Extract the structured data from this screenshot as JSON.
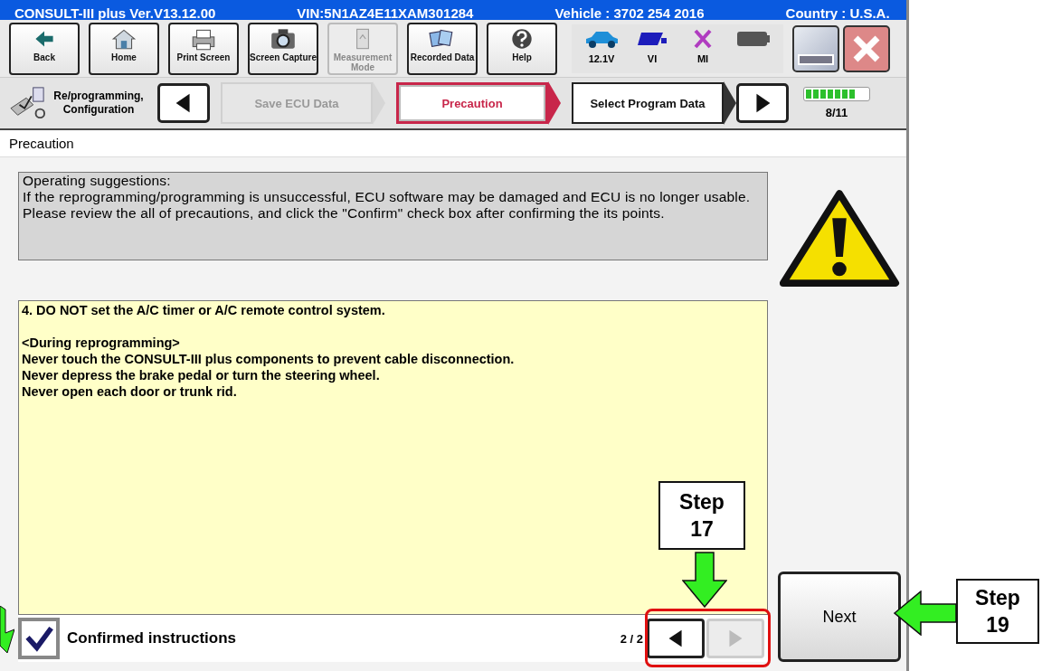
{
  "title_bar": {
    "app": "CONSULT-III plus  Ver.V13.12.00",
    "vin": "VIN:5N1AZ4E11XAM301284",
    "vehicle": "Vehicle : 3702 254 2016",
    "country": "Country : U.S.A."
  },
  "toolbar": [
    {
      "label": "Back",
      "kind": "back",
      "disabled": false
    },
    {
      "label": "Home",
      "kind": "home",
      "disabled": false
    },
    {
      "label": "Print Screen",
      "kind": "print",
      "disabled": false
    },
    {
      "label": "Screen Capture",
      "kind": "camera",
      "disabled": false
    },
    {
      "label": "Measurement Mode",
      "kind": "measure",
      "disabled": true
    },
    {
      "label": "Recorded Data",
      "kind": "recorded",
      "disabled": false
    },
    {
      "label": "Help",
      "kind": "help",
      "disabled": false
    }
  ],
  "status": [
    {
      "label": "12.1V",
      "kind": "car"
    },
    {
      "label": "VI",
      "kind": "vi"
    },
    {
      "label": "MI",
      "kind": "mi"
    },
    {
      "kind": "battery"
    }
  ],
  "breadcrumb": {
    "section": "Re/programming, Configuration",
    "steps": [
      {
        "label": "Save ECU Data",
        "selected": false,
        "disabled": true
      },
      {
        "label": "Precaution",
        "selected": true,
        "disabled": false
      },
      {
        "label": "Select Program Data",
        "selected": false,
        "disabled": false
      }
    ],
    "progress": {
      "level": 0.8,
      "label": "8/11"
    }
  },
  "page_title": "Precaution",
  "suggestions": {
    "heading": "Operating suggestions:",
    "lines": [
      "If the reprogramming/programming is unsuccessful, ECU software may be damaged and ECU is no longer usable.",
      "Please review the all of precautions, and click the \"Confirm\" check box after confirming the its points."
    ]
  },
  "instructions": [
    [
      "4. DO NOT set the A/C timer or A/C remote control system."
    ],
    [
      "<During  reprogramming>",
      "Never touch the CONSULT-III plus components to prevent cable disconnection.",
      "Never depress the brake pedal or turn the steering wheel.",
      "Never open each door or trunk rid."
    ]
  ],
  "confirm": {
    "label": "Confirmed instructions",
    "checked": true
  },
  "pager": {
    "label": "2 / 2",
    "prev_disabled": false,
    "next_disabled": true
  },
  "next_button": "Next",
  "callouts": [
    {
      "label": "Step 17",
      "kind": "down"
    },
    {
      "label": "Step 19",
      "kind": "left"
    }
  ]
}
